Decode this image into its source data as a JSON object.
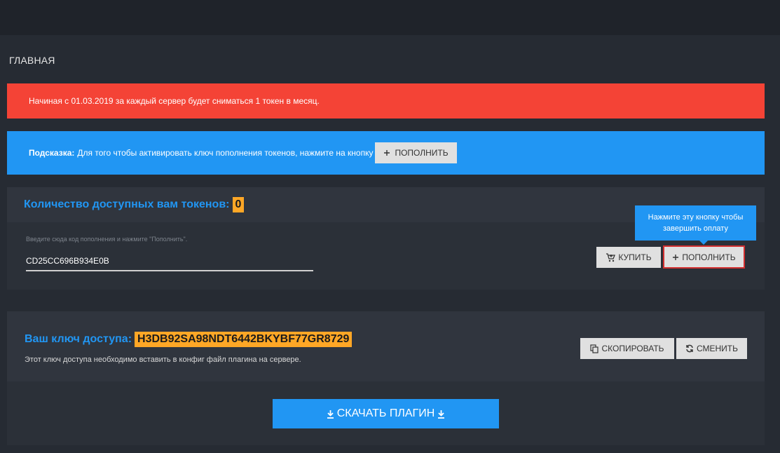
{
  "page": {
    "title": "ГЛАВНАЯ"
  },
  "alerts": {
    "warning_text": "Начиная с 01.03.2019 за каждый сервер будет сниматься 1 токен в месяц.",
    "hint_label": "Подсказка:",
    "hint_text": "Для того чтобы активировать ключ пополнения токенов, нажмите на кнопку",
    "hint_button": "ПОПОЛНИТЬ"
  },
  "tokens": {
    "title": "Количество доступных вам токенов:",
    "count": "0",
    "input_hint": "Введите сюда код пополнения и нажмите \"Пополнить\".",
    "input_value": "CD25CC696B934E0B",
    "tooltip": "Нажмите эту кнопку чтобы завершить оплату",
    "buy_label": "КУПИТЬ",
    "topup_label": "ПОПОЛНИТЬ"
  },
  "access_key": {
    "title": "Ваш ключ доступа:",
    "key": "H3DB92SA98NDT6442BKYBF77GR8729",
    "description": "Этот ключ доступа необходимо вставить в конфиг файл плагина на сервере.",
    "copy_label": "СКОПИРОВАТЬ",
    "change_label": "СМЕНИТЬ"
  },
  "download": {
    "label": "СКАЧАТЬ ПЛАГИН"
  },
  "colors": {
    "danger": "#f44336",
    "info": "#2196f3",
    "highlight": "#ffa726",
    "background": "#262b33"
  },
  "icons": [
    "plus-icon",
    "cart-icon",
    "copy-icon",
    "refresh-icon",
    "download-icon"
  ]
}
